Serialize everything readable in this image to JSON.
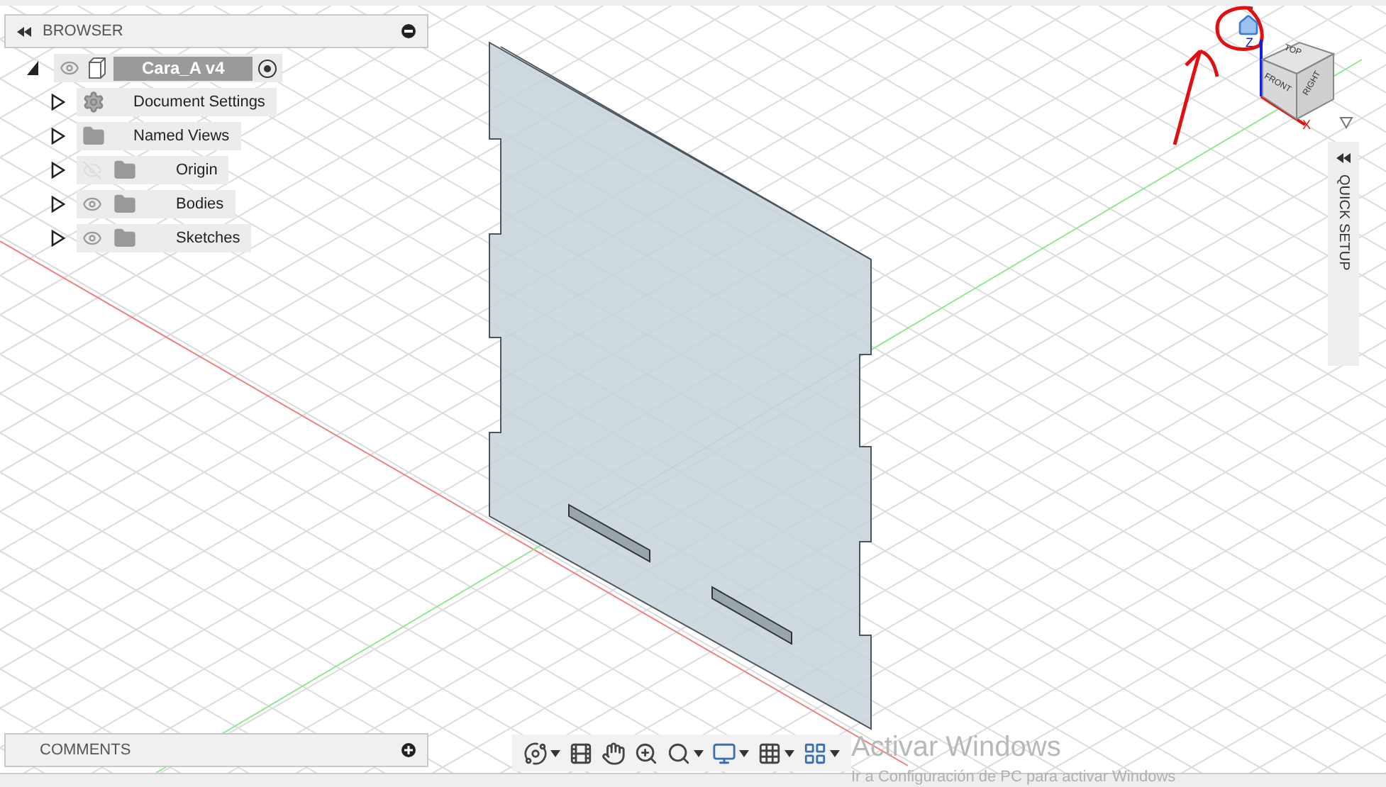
{
  "browser": {
    "title": "BROWSER",
    "root": {
      "label": "Cara_A v4",
      "visible": true,
      "expanded": true,
      "active": true,
      "children": [
        {
          "label": "Document Settings",
          "kind": "settings",
          "expanded": false
        },
        {
          "label": "Named Views",
          "kind": "folder",
          "expanded": false
        },
        {
          "label": "Origin",
          "kind": "folder",
          "visible": false,
          "expanded": false
        },
        {
          "label": "Bodies",
          "kind": "folder",
          "visible": true,
          "expanded": false
        },
        {
          "label": "Sketches",
          "kind": "folder",
          "visible": true,
          "expanded": false
        }
      ]
    }
  },
  "viewcube": {
    "top": "TOP",
    "front": "FRONT",
    "right": "RIGHT",
    "z_axis": "Z",
    "x_axis": "X"
  },
  "quick_setup": {
    "label": "QUICK SETUP"
  },
  "comments": {
    "title": "COMMENTS"
  },
  "toolbar": [
    {
      "kind": "orbit",
      "menu": true
    },
    {
      "kind": "look",
      "menu": false
    },
    {
      "kind": "pan",
      "menu": false
    },
    {
      "kind": "zoom",
      "menu": false
    },
    {
      "kind": "fit",
      "menu": true
    },
    {
      "kind": "display",
      "menu": true
    },
    {
      "kind": "grid",
      "menu": true
    },
    {
      "kind": "viewports",
      "menu": true
    }
  ],
  "activation": {
    "title": "Activar Windows",
    "detail": "Ir a Configuración de PC para activar Windows"
  }
}
